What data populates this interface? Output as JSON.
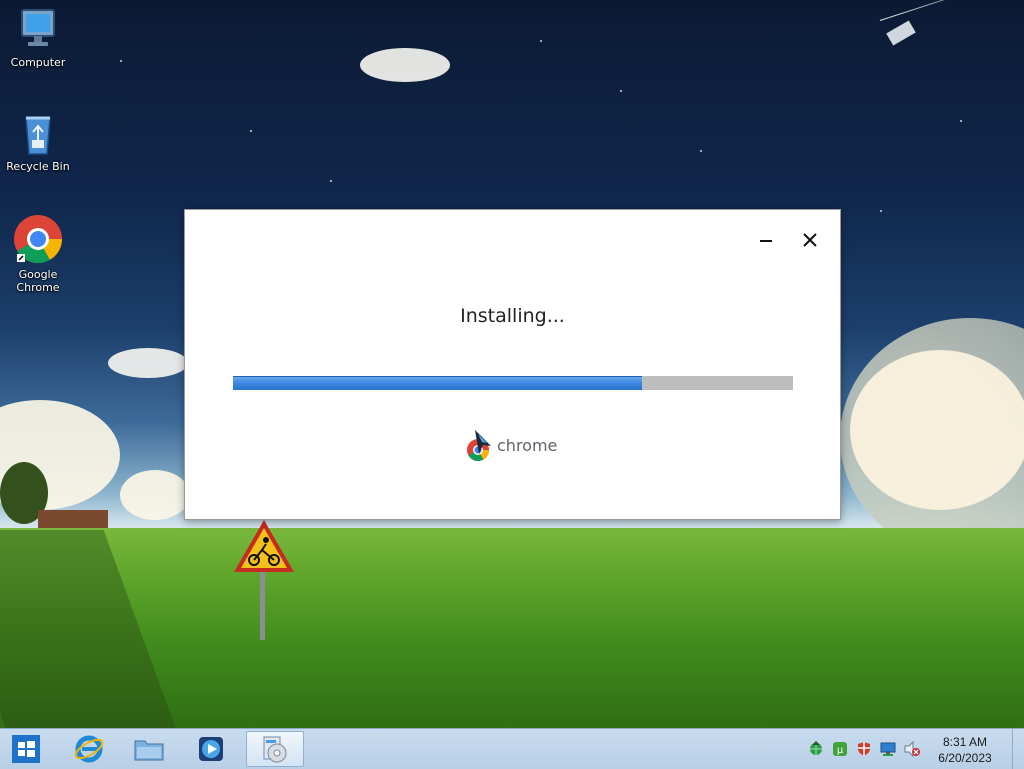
{
  "desktop": {
    "icons": [
      {
        "label": "Computer",
        "icon": "computer-icon"
      },
      {
        "label": "Recycle Bin",
        "icon": "recycle-bin-icon"
      },
      {
        "label": "Google\nChrome",
        "icon": "chrome-icon"
      }
    ]
  },
  "installer": {
    "status": "Installing...",
    "progress_percent": 73,
    "brand_text": "chrome",
    "minimize_icon": "minimize-icon",
    "close_icon": "close-icon"
  },
  "taskbar": {
    "pinned": [
      "start-icon",
      "internet-explorer-icon",
      "file-explorer-icon",
      "media-player-icon",
      "setup-disc-icon"
    ],
    "tray": [
      "network-globe-icon",
      "torrent-icon",
      "security-shield-icon",
      "display-network-icon",
      "volume-muted-icon"
    ],
    "time": "8:31 AM",
    "date": "6/20/2023"
  },
  "colors": {
    "progress_fill": "#3b86e1",
    "progress_track": "#bdbdbd",
    "taskbar": "#c3d8ec"
  }
}
